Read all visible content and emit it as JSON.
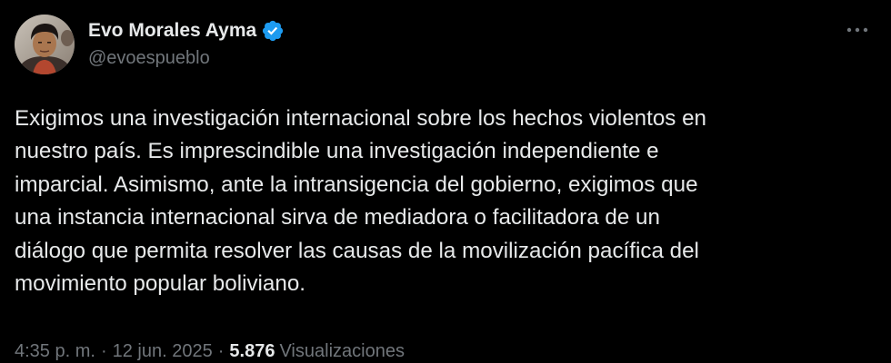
{
  "author": {
    "display_name": "Evo Morales Ayma",
    "handle": "@evoespueblo",
    "verified": true,
    "avatar_icon": "profile-photo",
    "verified_icon": "verified-badge-icon",
    "verified_color": "#1d9bf0"
  },
  "menu": {
    "icon": "more-options-icon"
  },
  "tweet": {
    "text": "Exigimos una investigación internacional sobre los hechos violentos en\nnuestro país. Es imprescindible una investigación independiente e\nimparcial. Asimismo, ante la intransigencia del gobierno, exigimos que\nuna instancia internacional sirva de mediadora o facilitadora de un\ndiálogo que permita resolver las causas de la movilización pacífica del\nmovimiento popular boliviano."
  },
  "meta": {
    "time": "4:35 p. m.",
    "separator": "·",
    "date": "12 jun. 2025",
    "views_count": "5.876",
    "views_label": "Visualizaciones"
  },
  "colors": {
    "background": "#000000",
    "primary_text": "#e7e9ea",
    "secondary_text": "#71767b"
  }
}
